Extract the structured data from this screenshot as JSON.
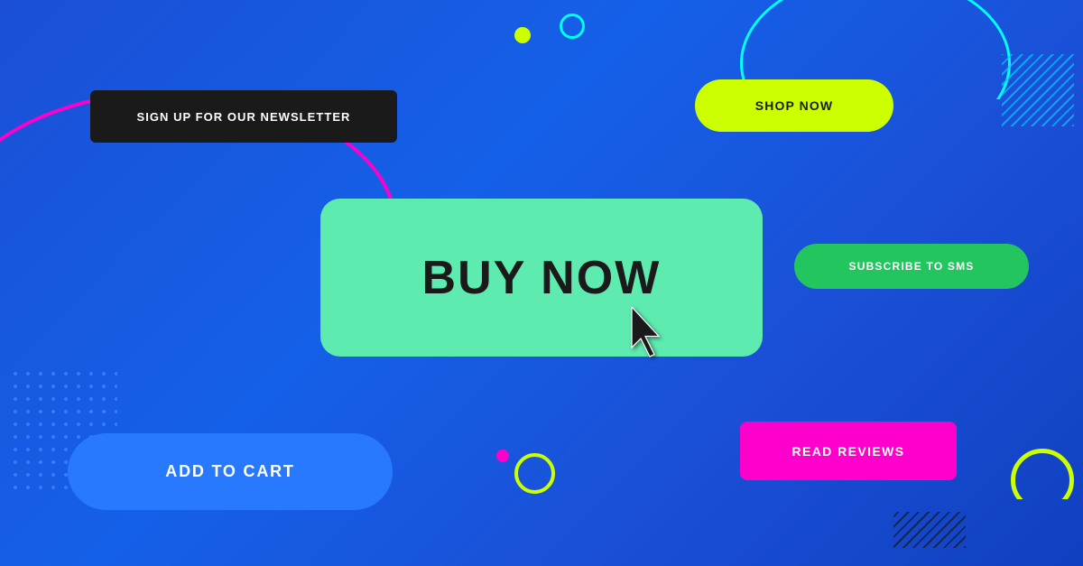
{
  "background": {
    "color": "#1a4fd6"
  },
  "buttons": {
    "newsletter": {
      "label": "SIGN UP FOR OUR NEWSLETTER",
      "bg": "#1a1a1a",
      "color": "#ffffff"
    },
    "shop_now": {
      "label": "SHOP NOW",
      "bg": "#ccff00",
      "color": "#1a1a1a"
    },
    "buy_now": {
      "label": "BUY NOW",
      "bg": "#5debb0",
      "color": "#1a1a1a"
    },
    "add_to_cart": {
      "label": "ADD TO CART",
      "bg": "#2979ff",
      "color": "#ffffff"
    },
    "subscribe": {
      "label": "SUBSCRIBE TO SMS",
      "bg": "#22c55e",
      "color": "#ffffff"
    },
    "read_reviews": {
      "label": "READ REVIEWS",
      "bg": "#ff00cc",
      "color": "#ffffff"
    }
  }
}
